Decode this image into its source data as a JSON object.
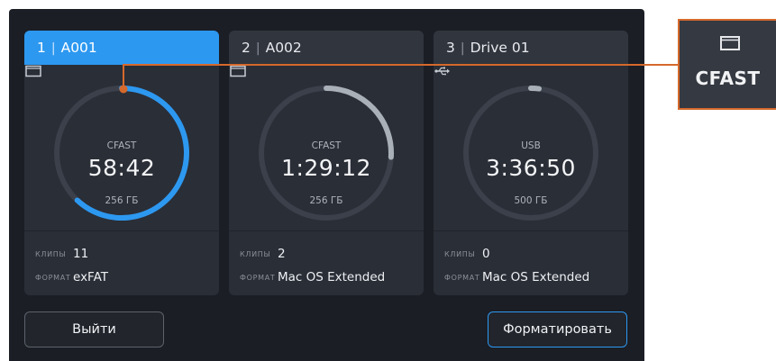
{
  "cards": [
    {
      "index": "1",
      "name": "A001",
      "media_type": "CFAST",
      "time": "58:42",
      "capacity": "256 ГБ",
      "clips_label": "КЛИПЫ",
      "clips": "11",
      "format_label": "ФОРМАТ",
      "format": "exFAT",
      "media_icon": "card-icon",
      "fill_fraction": 0.62,
      "selected": true
    },
    {
      "index": "2",
      "name": "A002",
      "media_type": "CFAST",
      "time": "1:29:12",
      "capacity": "256 ГБ",
      "clips_label": "КЛИПЫ",
      "clips": "2",
      "format_label": "ФОРМАТ",
      "format": "Mac OS Extended",
      "media_icon": "card-icon",
      "fill_fraction": 0.26,
      "selected": false
    },
    {
      "index": "3",
      "name": "Drive 01",
      "media_type": "USB",
      "time": "3:36:50",
      "capacity": "500 ГБ",
      "clips_label": "КЛИПЫ",
      "clips": "0",
      "format_label": "ФОРМАТ",
      "format": "Mac OS Extended",
      "media_icon": "usb-icon",
      "fill_fraction": 0.02,
      "selected": false
    }
  ],
  "buttons": {
    "exit": "Выйти",
    "format": "Форматировать"
  },
  "callout": {
    "label": "CFAST",
    "icon": "card-icon"
  },
  "colors": {
    "accent": "#2d98f0",
    "ring_track": "#3b404a",
    "ring_used": "#aab0b8",
    "callout_border": "#d5692c"
  }
}
